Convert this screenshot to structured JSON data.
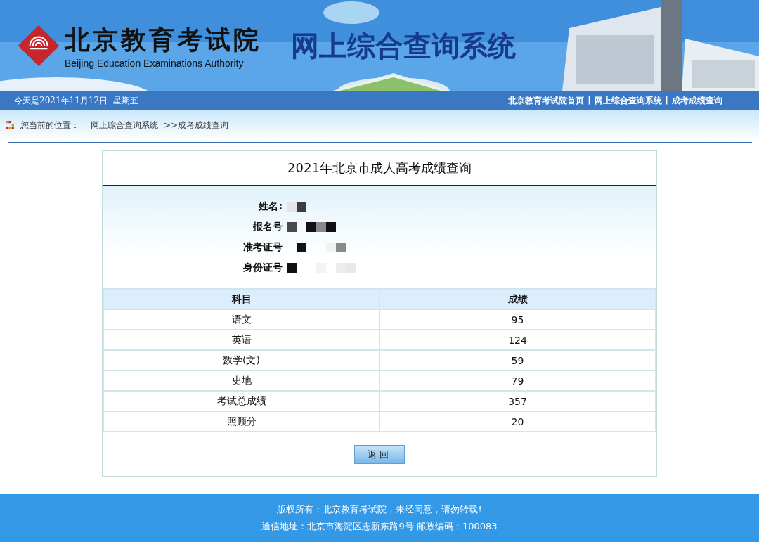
{
  "header": {
    "org_name": "北京教育考试院",
    "org_name_en": "Beijing Education Examinations Authority",
    "system_title": "网上综合查询系统"
  },
  "nav_bar": {
    "date": "今天是2021年11月12日  星期五",
    "links": [
      "北京教育考试院首页",
      "网上综合查询系统",
      "成考成绩查询"
    ],
    "separator": "|"
  },
  "breadcrumb": {
    "label": "您当前的位置：",
    "path": [
      "网上综合查询系统"
    ],
    "current": ">>成考成绩查询"
  },
  "result_card": {
    "title": "2021年北京市成人高考成绩查询",
    "fields": [
      {
        "label": "姓名:",
        "redacted": true
      },
      {
        "label": "报名号",
        "redacted": true
      },
      {
        "label": "准考证号",
        "redacted": true
      },
      {
        "label": "身份证号",
        "redacted": true
      }
    ],
    "columns": [
      "科目",
      "成绩"
    ],
    "rows": [
      [
        "语文",
        "95"
      ],
      [
        "英语",
        "124"
      ],
      [
        "数学(文)",
        "59"
      ],
      [
        "史地",
        "79"
      ],
      [
        "考试总成绩",
        "357"
      ],
      [
        "照顾分",
        "20"
      ]
    ],
    "back_button": "返回"
  },
  "footer": {
    "lines": [
      "版权所有：北京教育考试院，未经同意，请勿转载!",
      "通信地址：北京市海淀区志新东路9号 邮政编码：100083"
    ]
  }
}
